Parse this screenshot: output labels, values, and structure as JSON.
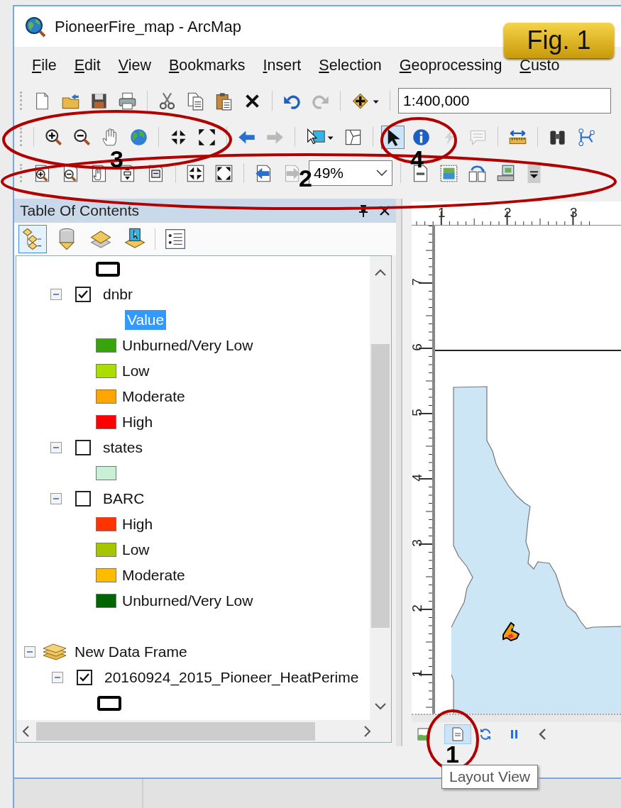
{
  "window": {
    "title": "PioneerFire_map - ArcMap"
  },
  "figure_badge": "Fig. 1",
  "menu": [
    "File",
    "Edit",
    "View",
    "Bookmarks",
    "Insert",
    "Selection",
    "Geoprocessing",
    "Custo"
  ],
  "toolbars": [
    {
      "tools": [
        {
          "disabled": false
        },
        {
          "disabled": false
        },
        {
          "disabled": false
        },
        {
          "disabled": false
        },
        {
          "disabled": false
        },
        {
          "disabled": false
        },
        {
          "disabled": false
        },
        {
          "disabled": false
        },
        {
          "disabled": false
        },
        {
          "disabled": true
        },
        {
          "disabled": false
        }
      ],
      "scale_box": {
        "value": "1:400,000"
      }
    },
    {
      "tools": [
        {
          "disabled": false,
          "selected": false
        },
        {
          "disabled": false,
          "selected": false
        },
        {
          "disabled": false,
          "selected": false
        },
        {
          "disabled": false,
          "selected": false
        },
        {
          "disabled": false,
          "selected": false
        },
        {
          "disabled": false,
          "selected": false
        },
        {
          "disabled": false,
          "selected": false
        },
        {
          "disabled": true,
          "selected": false
        },
        {
          "disabled": false,
          "selected": false
        },
        {
          "disabled": false,
          "selected": false
        },
        {
          "disabled": false,
          "selected": true
        },
        {
          "disabled": false,
          "selected": false
        },
        {
          "disabled": true,
          "selected": false
        },
        {
          "disabled": true,
          "selected": false
        },
        {
          "disabled": false,
          "selected": false
        },
        {
          "disabled": false,
          "selected": false
        },
        {
          "disabled": false,
          "selected": false
        }
      ]
    },
    {
      "tools": [
        {
          "disabled": false
        },
        {
          "disabled": false
        },
        {
          "disabled": false
        },
        {
          "disabled": false
        },
        {
          "disabled": false
        },
        {
          "disabled": false
        },
        {
          "disabled": false
        },
        {
          "disabled": false
        },
        {
          "disabled": true
        },
        {
          "disabled": false
        },
        {
          "disabled": false
        },
        {
          "disabled": false
        },
        {
          "disabled": false
        },
        {
          "disabled": false
        }
      ],
      "zoom_box": {
        "value": "49%"
      }
    }
  ],
  "toc": {
    "title": "Table Of Contents",
    "tabs": [
      {
        "selected": true
      },
      {
        "selected": false
      },
      {
        "selected": false
      },
      {
        "selected": false
      },
      {
        "selected": false
      }
    ],
    "tree": [
      {
        "kind": "symbol"
      },
      {
        "kind": "layer",
        "label": "dnbr",
        "checked": true,
        "expanded": true,
        "children": [
          {
            "kind": "heading",
            "label": "Value",
            "selected": true
          },
          {
            "kind": "class",
            "label": "Unburned/Very Low",
            "color": "#38a30c"
          },
          {
            "kind": "class",
            "label": "Low",
            "color": "#aade00"
          },
          {
            "kind": "class",
            "label": "Moderate",
            "color": "#ffa500"
          },
          {
            "kind": "class",
            "label": "High",
            "color": "#ff0000"
          }
        ]
      },
      {
        "kind": "layer",
        "label": "states",
        "checked": false,
        "expanded": true,
        "children": [
          {
            "kind": "class",
            "color": "#c8f0d4"
          }
        ]
      },
      {
        "kind": "layer",
        "label": "BARC",
        "checked": false,
        "expanded": true,
        "children": [
          {
            "kind": "class",
            "label": "High",
            "color": "#ff3300"
          },
          {
            "kind": "class",
            "label": "Low",
            "color": "#a6c400"
          },
          {
            "kind": "class",
            "label": "Moderate",
            "color": "#ffbb00"
          },
          {
            "kind": "class",
            "label": "Unburned/Very Low",
            "color": "#006400"
          }
        ]
      },
      {
        "kind": "data_frame",
        "label": "New Data Frame",
        "expanded": true,
        "children": [
          {
            "kind": "layer",
            "label": "20160924_2015_Pioneer_HeatPerime",
            "checked": true,
            "expanded": true,
            "children": [
              {
                "kind": "symbol"
              }
            ]
          }
        ]
      }
    ]
  },
  "layout": {
    "rulers": {
      "horizontal": [
        "1",
        "2",
        "3"
      ],
      "vertical": [
        "7",
        "6",
        "5",
        "4",
        "3",
        "2",
        "1"
      ]
    },
    "view_buttons": [
      {
        "selected": false
      },
      {
        "selected": true
      }
    ]
  },
  "tooltip": "Layout View",
  "annotations": [
    {
      "label": "3"
    },
    {
      "label": "2"
    },
    {
      "label": "4"
    },
    {
      "label": "1"
    }
  ]
}
